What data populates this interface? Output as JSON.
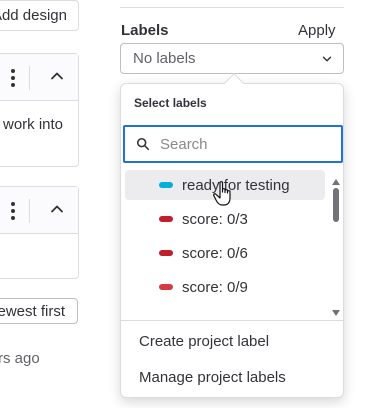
{
  "left_panel": {
    "add_design_label": "Add design",
    "card1_text": "work into",
    "sort_label": "Newest first",
    "time_ago": "rs ago"
  },
  "labels": {
    "title": "Labels",
    "apply": "Apply",
    "dropdown_value": "No labels",
    "popover_title": "Select labels",
    "search_placeholder": "Search",
    "items": [
      {
        "name": "ready for testing",
        "color": "#00b0d6"
      },
      {
        "name": "score: 0/3",
        "color": "#c21e2c"
      },
      {
        "name": "score: 0/6",
        "color": "#c21e2c"
      },
      {
        "name": "score: 0/9",
        "color": "#d63a41"
      }
    ],
    "create_label": "Create project label",
    "manage_label": "Manage project labels"
  },
  "icons": {
    "kebab": "ellipsis-v-icon",
    "chevron_up": "chevron-up-icon",
    "chevron_down": "chevron-down-icon",
    "search": "search-icon",
    "cursor": "hand-pointer-icon"
  }
}
